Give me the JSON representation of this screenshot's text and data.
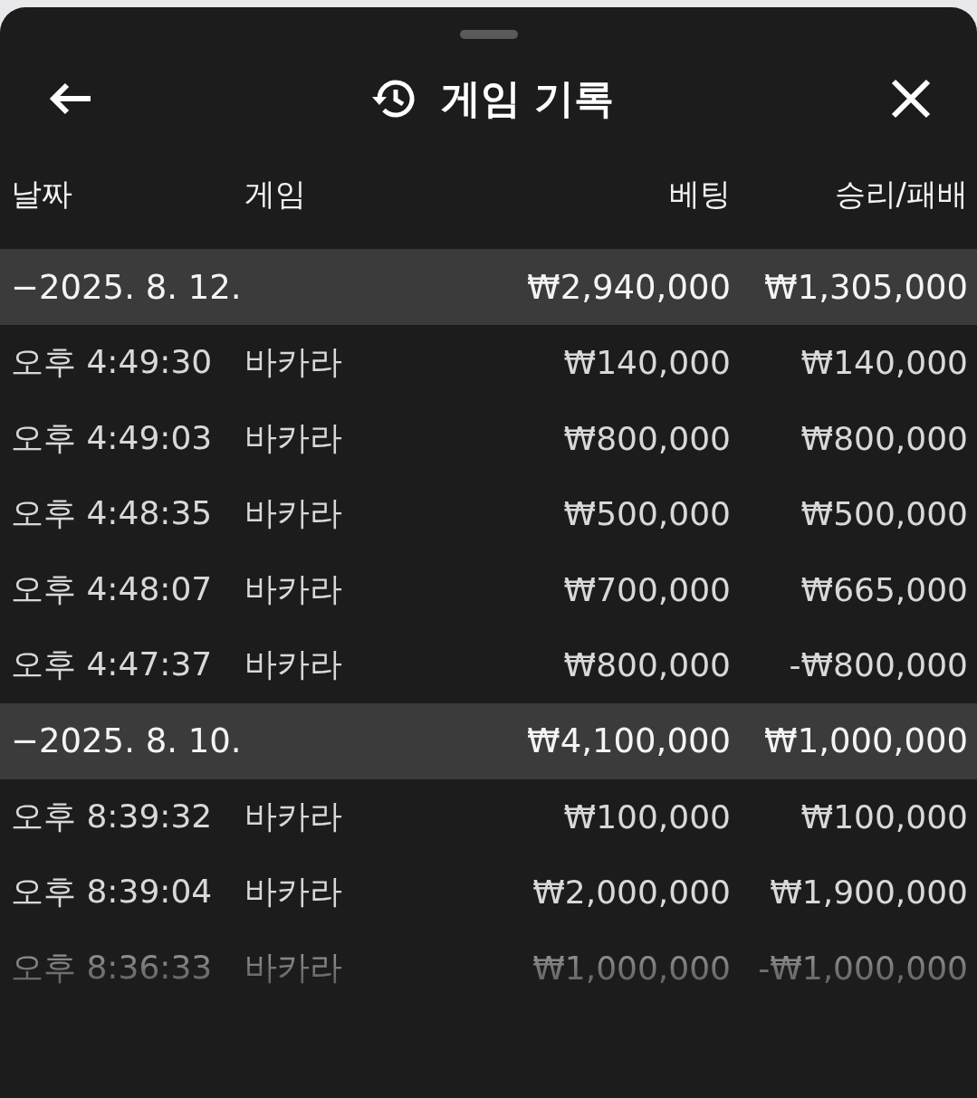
{
  "header": {
    "title": "게임 기록"
  },
  "columns": [
    "날짜",
    "게임",
    "베팅",
    "승리/패배"
  ],
  "groups": [
    {
      "date": "−2025. 8. 12.",
      "bet": "₩2,940,000",
      "result": "₩1,305,000",
      "rows": [
        {
          "time": "오후 4:49:30",
          "game": "바카라",
          "bet": "₩140,000",
          "result": "₩140,000"
        },
        {
          "time": "오후 4:49:03",
          "game": "바카라",
          "bet": "₩800,000",
          "result": "₩800,000"
        },
        {
          "time": "오후 4:48:35",
          "game": "바카라",
          "bet": "₩500,000",
          "result": "₩500,000"
        },
        {
          "time": "오후 4:48:07",
          "game": "바카라",
          "bet": "₩700,000",
          "result": "₩665,000"
        },
        {
          "time": "오후 4:47:37",
          "game": "바카라",
          "bet": "₩800,000",
          "result": "-₩800,000"
        }
      ]
    },
    {
      "date": "−2025. 8. 10.",
      "bet": "₩4,100,000",
      "result": "₩1,000,000",
      "rows": [
        {
          "time": "오후 8:39:32",
          "game": "바카라",
          "bet": "₩100,000",
          "result": "₩100,000"
        },
        {
          "time": "오후 8:39:04",
          "game": "바카라",
          "bet": "₩2,000,000",
          "result": "₩1,900,000"
        },
        {
          "time": "오후 8:36:33",
          "game": "바카라",
          "bet": "₩1,000,000",
          "result": "-₩1,000,000"
        }
      ]
    }
  ]
}
